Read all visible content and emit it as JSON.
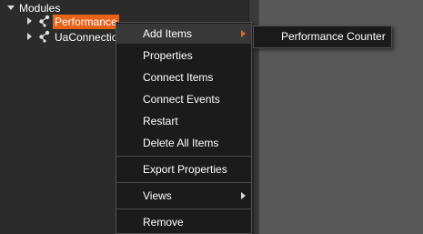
{
  "tree": {
    "root_label": "Modules",
    "children": [
      {
        "label": "Performance",
        "selected": true
      },
      {
        "label": "UaConnectio",
        "selected": false
      }
    ],
    "node_icon": "module-node-icon",
    "expander_icons": [
      "chevron-down-icon",
      "chevron-right-icon"
    ],
    "selection_color": "#e9621a"
  },
  "context_menu": {
    "items": [
      {
        "label": "Add Items",
        "has_submenu": true,
        "highlighted": true
      },
      {
        "label": "Properties"
      },
      {
        "label": "Connect Items"
      },
      {
        "label": "Connect Events"
      },
      {
        "label": "Restart"
      },
      {
        "label": "Delete All Items"
      },
      {
        "label": "Export Properties"
      },
      {
        "label": "Views",
        "has_submenu": true
      },
      {
        "label": "Remove"
      }
    ],
    "submenu_arrow_colors": {
      "active": "#e9621a",
      "normal": "#d8d8d8"
    }
  },
  "submenu": {
    "items": [
      {
        "label": "Performance Counter"
      }
    ]
  }
}
